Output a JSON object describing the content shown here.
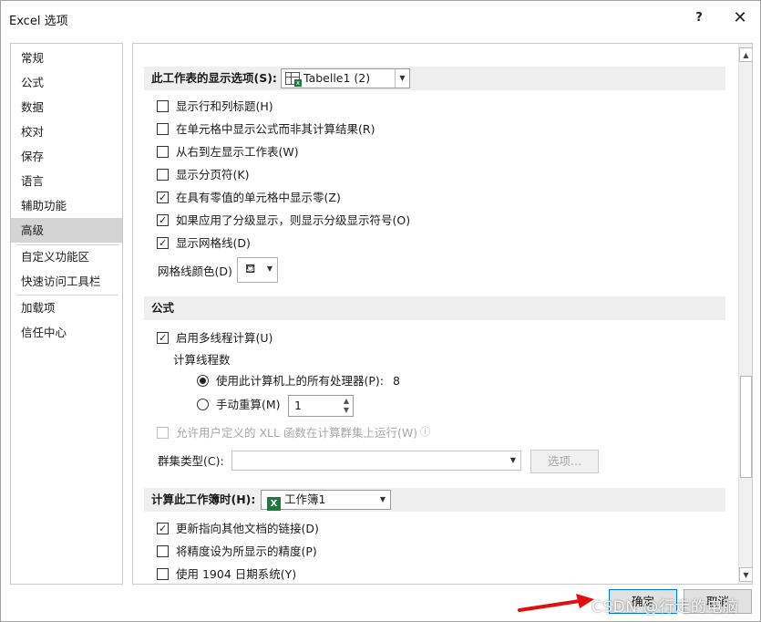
{
  "window": {
    "title": "Excel 选项",
    "help": "?",
    "close": "✕"
  },
  "sidebar": {
    "items": [
      {
        "label": "常规"
      },
      {
        "label": "公式"
      },
      {
        "label": "数据"
      },
      {
        "label": "校对"
      },
      {
        "label": "保存"
      },
      {
        "label": "语言"
      },
      {
        "label": "辅助功能"
      },
      {
        "label": "高级"
      },
      {
        "label": "自定义功能区"
      },
      {
        "label": "快速访问工具栏"
      },
      {
        "label": "加载项"
      },
      {
        "label": "信任中心"
      }
    ],
    "active": "高级"
  },
  "worksheet_section": {
    "title": "此工作表的显示选项(S):",
    "combo_value": "Tabelle1 (2)",
    "options": [
      {
        "label": "显示行和列标题(H)",
        "checked": false
      },
      {
        "label": "在单元格中显示公式而非其计算结果(R)",
        "checked": false
      },
      {
        "label": "从右到左显示工作表(W)",
        "checked": false
      },
      {
        "label": "显示分页符(K)",
        "checked": false
      },
      {
        "label": "在具有零值的单元格中显示零(Z)",
        "checked": true
      },
      {
        "label": "如果应用了分级显示，则显示分级显示符号(O)",
        "checked": true
      },
      {
        "label": "显示网格线(D)",
        "checked": true
      }
    ],
    "gridline_color_label": "网格线颜色(D)"
  },
  "formula_section": {
    "title": "公式",
    "multithread": {
      "label": "启用多线程计算(U)",
      "checked": true
    },
    "threads_label": "计算线程数",
    "radio_all": {
      "label": "使用此计算机上的所有处理器(P):",
      "value": "8",
      "checked": true
    },
    "radio_manual": {
      "label": "手动重算(M)",
      "checked": false,
      "value": "1"
    },
    "xll": {
      "label": "允许用户定义的 XLL 函数在计算群集上运行(W)",
      "checked": false,
      "info_icon": "ⓘ"
    },
    "cluster_type_label": "群集类型(C):",
    "cluster_type_value": "",
    "options_button": "选项..."
  },
  "workbook_section": {
    "title": "计算此工作簿时(H):",
    "combo_value": "工作簿1",
    "options": [
      {
        "label": "更新指向其他文档的链接(D)",
        "checked": true
      },
      {
        "label": "将精度设为所显示的精度(P)",
        "checked": false
      },
      {
        "label": "使用 1904 日期系统(Y)",
        "checked": false
      }
    ]
  },
  "footer": {
    "ok": "确定",
    "cancel": "取消"
  },
  "watermark": "CSDN @行走的电脑",
  "colors": {
    "annotation_arrow": "#e01010",
    "section_bg": "#efefef",
    "active_nav": "#d4d4d4",
    "excel_green": "#1d7a3e"
  }
}
